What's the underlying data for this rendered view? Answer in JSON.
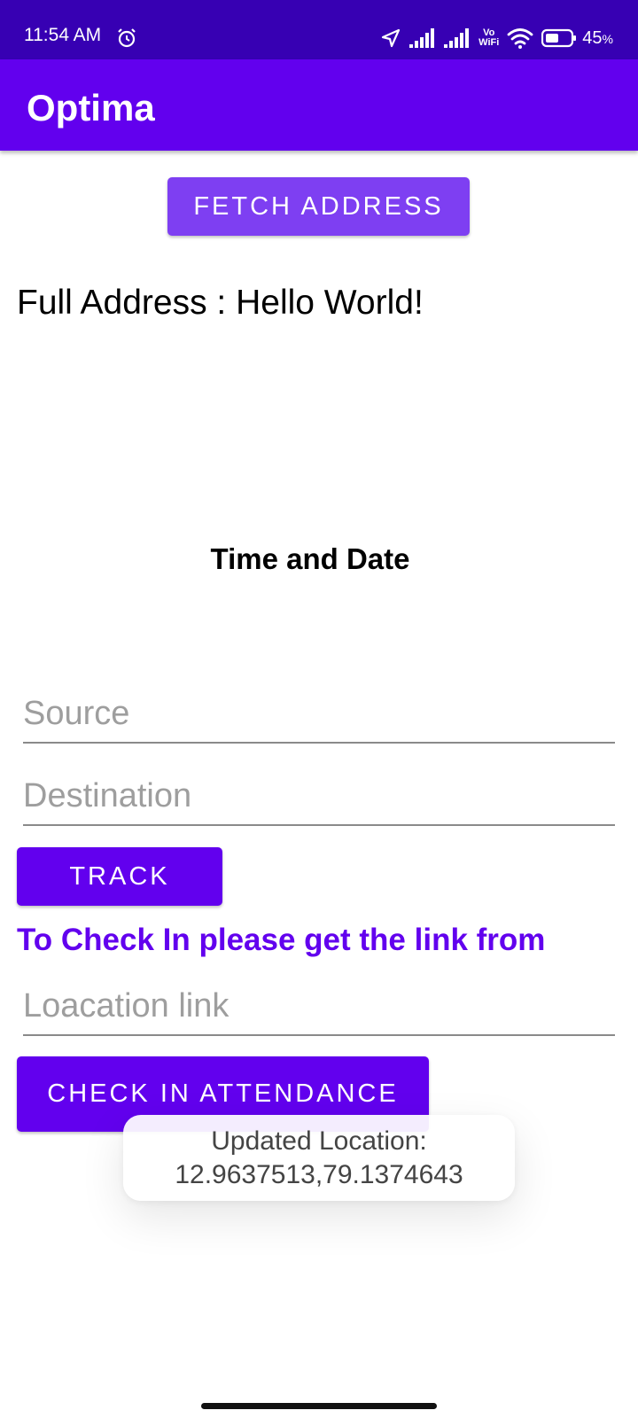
{
  "status_bar": {
    "time": "11:54 AM",
    "vowifi_top": "Vo",
    "vowifi_bottom": "WiFi",
    "battery": "45",
    "battery_unit": "%",
    "icons": [
      "alarm-icon",
      "location-arrow-icon",
      "signal-icon",
      "signal-icon",
      "vowifi-icon",
      "wifi-icon",
      "battery-icon"
    ]
  },
  "app_bar": {
    "title": "Optima",
    "color": "#6200ee"
  },
  "main": {
    "fetch_button": "FETCH ADDRESS",
    "full_address": "Full Address : Hello World!",
    "time_date": "Time and Date",
    "source_placeholder": "Source",
    "destination_placeholder": "Destination",
    "track_button": "TRACK",
    "checkin_note": "To Check In please get the link from",
    "link_placeholder": "Loacation link",
    "checkin_button": "CHECK IN ATTENDANCE"
  },
  "toast": {
    "line1": "Updated Location:",
    "line2": "12.9637513,79.1374643"
  },
  "colors": {
    "status_bar": "#3700b3",
    "primary": "#6200ee",
    "fetch_button": "#7e3ff2"
  }
}
